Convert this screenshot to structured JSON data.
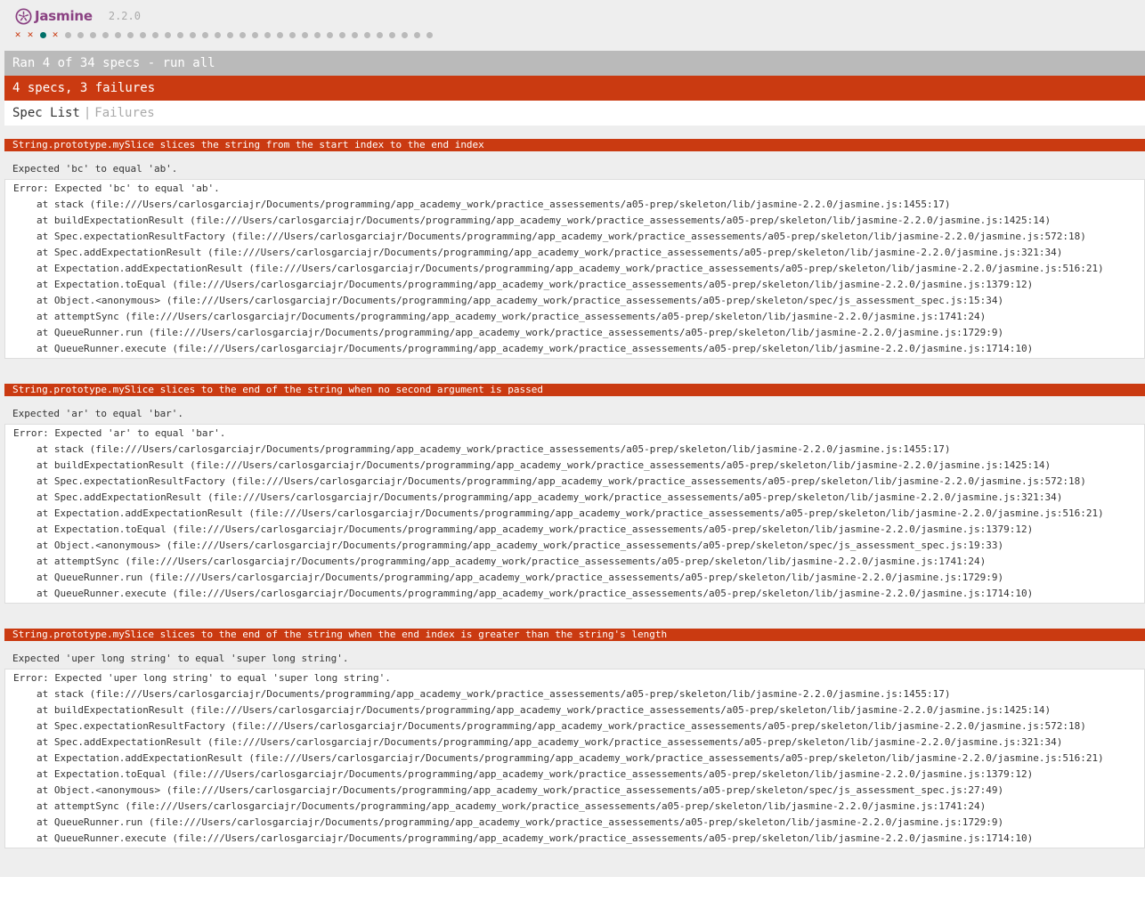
{
  "banner": {
    "title": "Jasmine",
    "version": "2.2.0"
  },
  "symbol_summary": [
    "failed",
    "failed",
    "passed",
    "failed",
    "pending",
    "pending",
    "pending",
    "pending",
    "pending",
    "pending",
    "pending",
    "pending",
    "pending",
    "pending",
    "pending",
    "pending",
    "pending",
    "pending",
    "pending",
    "pending",
    "pending",
    "pending",
    "pending",
    "pending",
    "pending",
    "pending",
    "pending",
    "pending",
    "pending",
    "pending",
    "pending",
    "pending",
    "pending",
    "pending"
  ],
  "status": {
    "ran_label": "Ran 4 of 34 specs - run all",
    "summary_label": "4 specs, 3 failures"
  },
  "menu": {
    "spec_list": "Spec List",
    "separator": "|",
    "failures": "Failures"
  },
  "colors": {
    "failed": "#ca3a11",
    "passed": "#007069",
    "pending": "#bababa",
    "brand": "#8a4182"
  },
  "failures": [
    {
      "description": "String.prototype.mySlice slices the string from the start index to the end index",
      "message": "Expected 'bc' to equal 'ab'.",
      "error": "Error: Expected 'bc' to equal 'ab'.",
      "frames": [
        "at stack (file:///Users/carlosgarciajr/Documents/programming/app_academy_work/practice_assessements/a05-prep/skeleton/lib/jasmine-2.2.0/jasmine.js:1455:17)",
        "at buildExpectationResult (file:///Users/carlosgarciajr/Documents/programming/app_academy_work/practice_assessements/a05-prep/skeleton/lib/jasmine-2.2.0/jasmine.js:1425:14)",
        "at Spec.expectationResultFactory (file:///Users/carlosgarciajr/Documents/programming/app_academy_work/practice_assessements/a05-prep/skeleton/lib/jasmine-2.2.0/jasmine.js:572:18)",
        "at Spec.addExpectationResult (file:///Users/carlosgarciajr/Documents/programming/app_academy_work/practice_assessements/a05-prep/skeleton/lib/jasmine-2.2.0/jasmine.js:321:34)",
        "at Expectation.addExpectationResult (file:///Users/carlosgarciajr/Documents/programming/app_academy_work/practice_assessements/a05-prep/skeleton/lib/jasmine-2.2.0/jasmine.js:516:21)",
        "at Expectation.toEqual (file:///Users/carlosgarciajr/Documents/programming/app_academy_work/practice_assessements/a05-prep/skeleton/lib/jasmine-2.2.0/jasmine.js:1379:12)",
        "at Object.<anonymous> (file:///Users/carlosgarciajr/Documents/programming/app_academy_work/practice_assessements/a05-prep/skeleton/spec/js_assessment_spec.js:15:34)",
        "at attemptSync (file:///Users/carlosgarciajr/Documents/programming/app_academy_work/practice_assessements/a05-prep/skeleton/lib/jasmine-2.2.0/jasmine.js:1741:24)",
        "at QueueRunner.run (file:///Users/carlosgarciajr/Documents/programming/app_academy_work/practice_assessements/a05-prep/skeleton/lib/jasmine-2.2.0/jasmine.js:1729:9)",
        "at QueueRunner.execute (file:///Users/carlosgarciajr/Documents/programming/app_academy_work/practice_assessements/a05-prep/skeleton/lib/jasmine-2.2.0/jasmine.js:1714:10)"
      ]
    },
    {
      "description": "String.prototype.mySlice slices to the end of the string when no second argument is passed",
      "message": "Expected 'ar' to equal 'bar'.",
      "error": "Error: Expected 'ar' to equal 'bar'.",
      "frames": [
        "at stack (file:///Users/carlosgarciajr/Documents/programming/app_academy_work/practice_assessements/a05-prep/skeleton/lib/jasmine-2.2.0/jasmine.js:1455:17)",
        "at buildExpectationResult (file:///Users/carlosgarciajr/Documents/programming/app_academy_work/practice_assessements/a05-prep/skeleton/lib/jasmine-2.2.0/jasmine.js:1425:14)",
        "at Spec.expectationResultFactory (file:///Users/carlosgarciajr/Documents/programming/app_academy_work/practice_assessements/a05-prep/skeleton/lib/jasmine-2.2.0/jasmine.js:572:18)",
        "at Spec.addExpectationResult (file:///Users/carlosgarciajr/Documents/programming/app_academy_work/practice_assessements/a05-prep/skeleton/lib/jasmine-2.2.0/jasmine.js:321:34)",
        "at Expectation.addExpectationResult (file:///Users/carlosgarciajr/Documents/programming/app_academy_work/practice_assessements/a05-prep/skeleton/lib/jasmine-2.2.0/jasmine.js:516:21)",
        "at Expectation.toEqual (file:///Users/carlosgarciajr/Documents/programming/app_academy_work/practice_assessements/a05-prep/skeleton/lib/jasmine-2.2.0/jasmine.js:1379:12)",
        "at Object.<anonymous> (file:///Users/carlosgarciajr/Documents/programming/app_academy_work/practice_assessements/a05-prep/skeleton/spec/js_assessment_spec.js:19:33)",
        "at attemptSync (file:///Users/carlosgarciajr/Documents/programming/app_academy_work/practice_assessements/a05-prep/skeleton/lib/jasmine-2.2.0/jasmine.js:1741:24)",
        "at QueueRunner.run (file:///Users/carlosgarciajr/Documents/programming/app_academy_work/practice_assessements/a05-prep/skeleton/lib/jasmine-2.2.0/jasmine.js:1729:9)",
        "at QueueRunner.execute (file:///Users/carlosgarciajr/Documents/programming/app_academy_work/practice_assessements/a05-prep/skeleton/lib/jasmine-2.2.0/jasmine.js:1714:10)"
      ]
    },
    {
      "description": "String.prototype.mySlice slices to the end of the string when the end index is greater than the string's length",
      "message": "Expected 'uper long string' to equal 'super long string'.",
      "error": "Error: Expected 'uper long string' to equal 'super long string'.",
      "frames": [
        "at stack (file:///Users/carlosgarciajr/Documents/programming/app_academy_work/practice_assessements/a05-prep/skeleton/lib/jasmine-2.2.0/jasmine.js:1455:17)",
        "at buildExpectationResult (file:///Users/carlosgarciajr/Documents/programming/app_academy_work/practice_assessements/a05-prep/skeleton/lib/jasmine-2.2.0/jasmine.js:1425:14)",
        "at Spec.expectationResultFactory (file:///Users/carlosgarciajr/Documents/programming/app_academy_work/practice_assessements/a05-prep/skeleton/lib/jasmine-2.2.0/jasmine.js:572:18)",
        "at Spec.addExpectationResult (file:///Users/carlosgarciajr/Documents/programming/app_academy_work/practice_assessements/a05-prep/skeleton/lib/jasmine-2.2.0/jasmine.js:321:34)",
        "at Expectation.addExpectationResult (file:///Users/carlosgarciajr/Documents/programming/app_academy_work/practice_assessements/a05-prep/skeleton/lib/jasmine-2.2.0/jasmine.js:516:21)",
        "at Expectation.toEqual (file:///Users/carlosgarciajr/Documents/programming/app_academy_work/practice_assessements/a05-prep/skeleton/lib/jasmine-2.2.0/jasmine.js:1379:12)",
        "at Object.<anonymous> (file:///Users/carlosgarciajr/Documents/programming/app_academy_work/practice_assessements/a05-prep/skeleton/spec/js_assessment_spec.js:27:49)",
        "at attemptSync (file:///Users/carlosgarciajr/Documents/programming/app_academy_work/practice_assessements/a05-prep/skeleton/lib/jasmine-2.2.0/jasmine.js:1741:24)",
        "at QueueRunner.run (file:///Users/carlosgarciajr/Documents/programming/app_academy_work/practice_assessements/a05-prep/skeleton/lib/jasmine-2.2.0/jasmine.js:1729:9)",
        "at QueueRunner.execute (file:///Users/carlosgarciajr/Documents/programming/app_academy_work/practice_assessements/a05-prep/skeleton/lib/jasmine-2.2.0/jasmine.js:1714:10)"
      ]
    }
  ]
}
